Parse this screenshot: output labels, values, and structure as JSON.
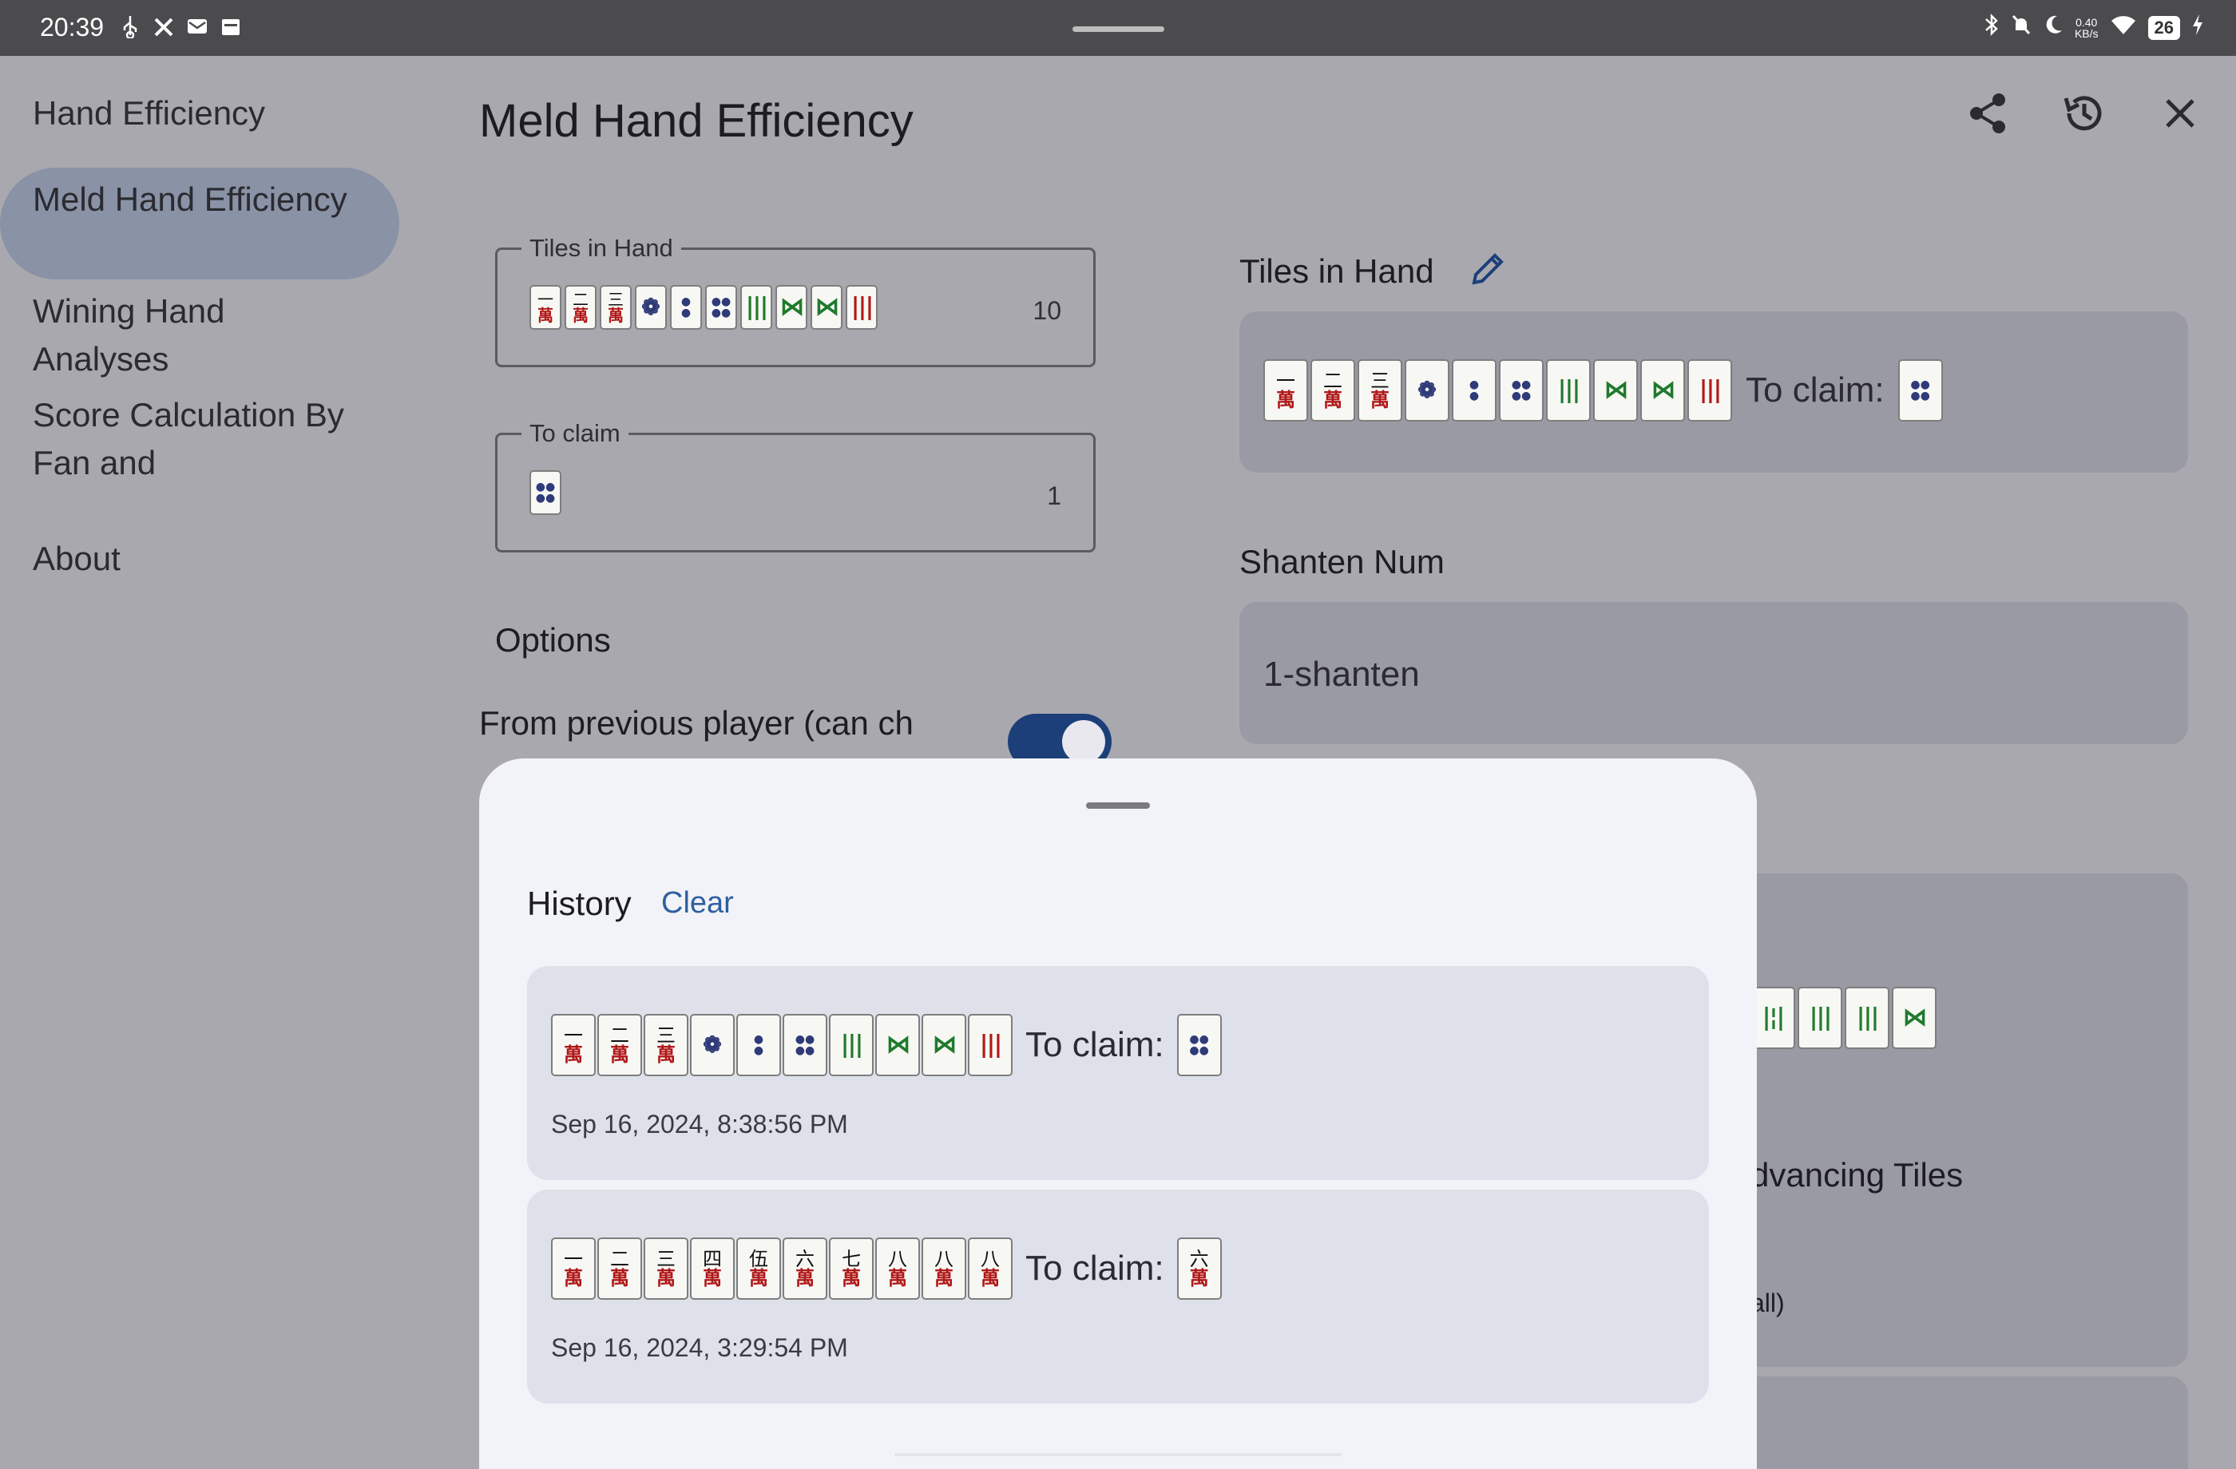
{
  "status_bar": {
    "time": "20:39",
    "net_speed_value": "0.40",
    "net_speed_unit": "KB/s",
    "battery": "26"
  },
  "nav": {
    "title": "Hand Efficiency",
    "items": [
      {
        "label": "Meld Hand Efficiency",
        "active": true
      },
      {
        "label": "Wining Hand Analyses",
        "active": false
      },
      {
        "label": "Score Calculation By Fan and",
        "active": false
      },
      {
        "label": "About",
        "active": false
      }
    ]
  },
  "main": {
    "title": "Meld Hand Efficiency",
    "tiles_field": {
      "label": "Tiles in Hand",
      "count": "10"
    },
    "claim_field": {
      "label": "To claim",
      "count": "1"
    },
    "options_title": "Options",
    "option_previous_player": "From previous player (can ch",
    "right_tiles_title": "Tiles in Hand",
    "to_claim_label": "To claim:",
    "shanten_title": "Shanten Num",
    "shanten_value": "1-shanten",
    "partial_advancing": "dvancing Tiles",
    "partial_all": "all)"
  },
  "history": {
    "title": "History",
    "clear_label": "Clear",
    "to_claim_label": "To claim:",
    "entries": [
      {
        "time": "Sep 16, 2024, 8:38:56 PM"
      },
      {
        "time": "Sep 16, 2024, 3:29:54 PM"
      }
    ]
  },
  "tiles": {
    "hand1": [
      {
        "kind": "man",
        "num": "一"
      },
      {
        "kind": "man",
        "num": "二"
      },
      {
        "kind": "man",
        "num": "三"
      },
      {
        "kind": "pin",
        "num": "1"
      },
      {
        "kind": "pin",
        "num": "2"
      },
      {
        "kind": "pin",
        "num": "4"
      },
      {
        "kind": "sou",
        "num": "6"
      },
      {
        "kind": "sou",
        "num": "8"
      },
      {
        "kind": "sou",
        "num": "8"
      },
      {
        "kind": "sou",
        "num": "9"
      }
    ],
    "claim1": {
      "kind": "pin",
      "num": "4"
    },
    "hand2": [
      {
        "kind": "man",
        "num": "一"
      },
      {
        "kind": "man",
        "num": "二"
      },
      {
        "kind": "man",
        "num": "三"
      },
      {
        "kind": "man",
        "num": "四"
      },
      {
        "kind": "man",
        "num": "伍"
      },
      {
        "kind": "man",
        "num": "六"
      },
      {
        "kind": "man",
        "num": "七"
      },
      {
        "kind": "man",
        "num": "八"
      },
      {
        "kind": "man",
        "num": "八"
      },
      {
        "kind": "man",
        "num": "八"
      }
    ],
    "claim2": {
      "kind": "man",
      "num": "六"
    },
    "partial_row": [
      {
        "kind": "sou",
        "num": "7"
      },
      {
        "kind": "sou",
        "num": "6"
      },
      {
        "kind": "sou",
        "num": "5"
      },
      {
        "kind": "sou",
        "num": "8"
      }
    ]
  },
  "colors": {
    "accent": "#1c3f7a",
    "link": "#2f5fa0",
    "sheet_bg": "#f2f3f8",
    "card_bg": "#dfe1ea"
  }
}
